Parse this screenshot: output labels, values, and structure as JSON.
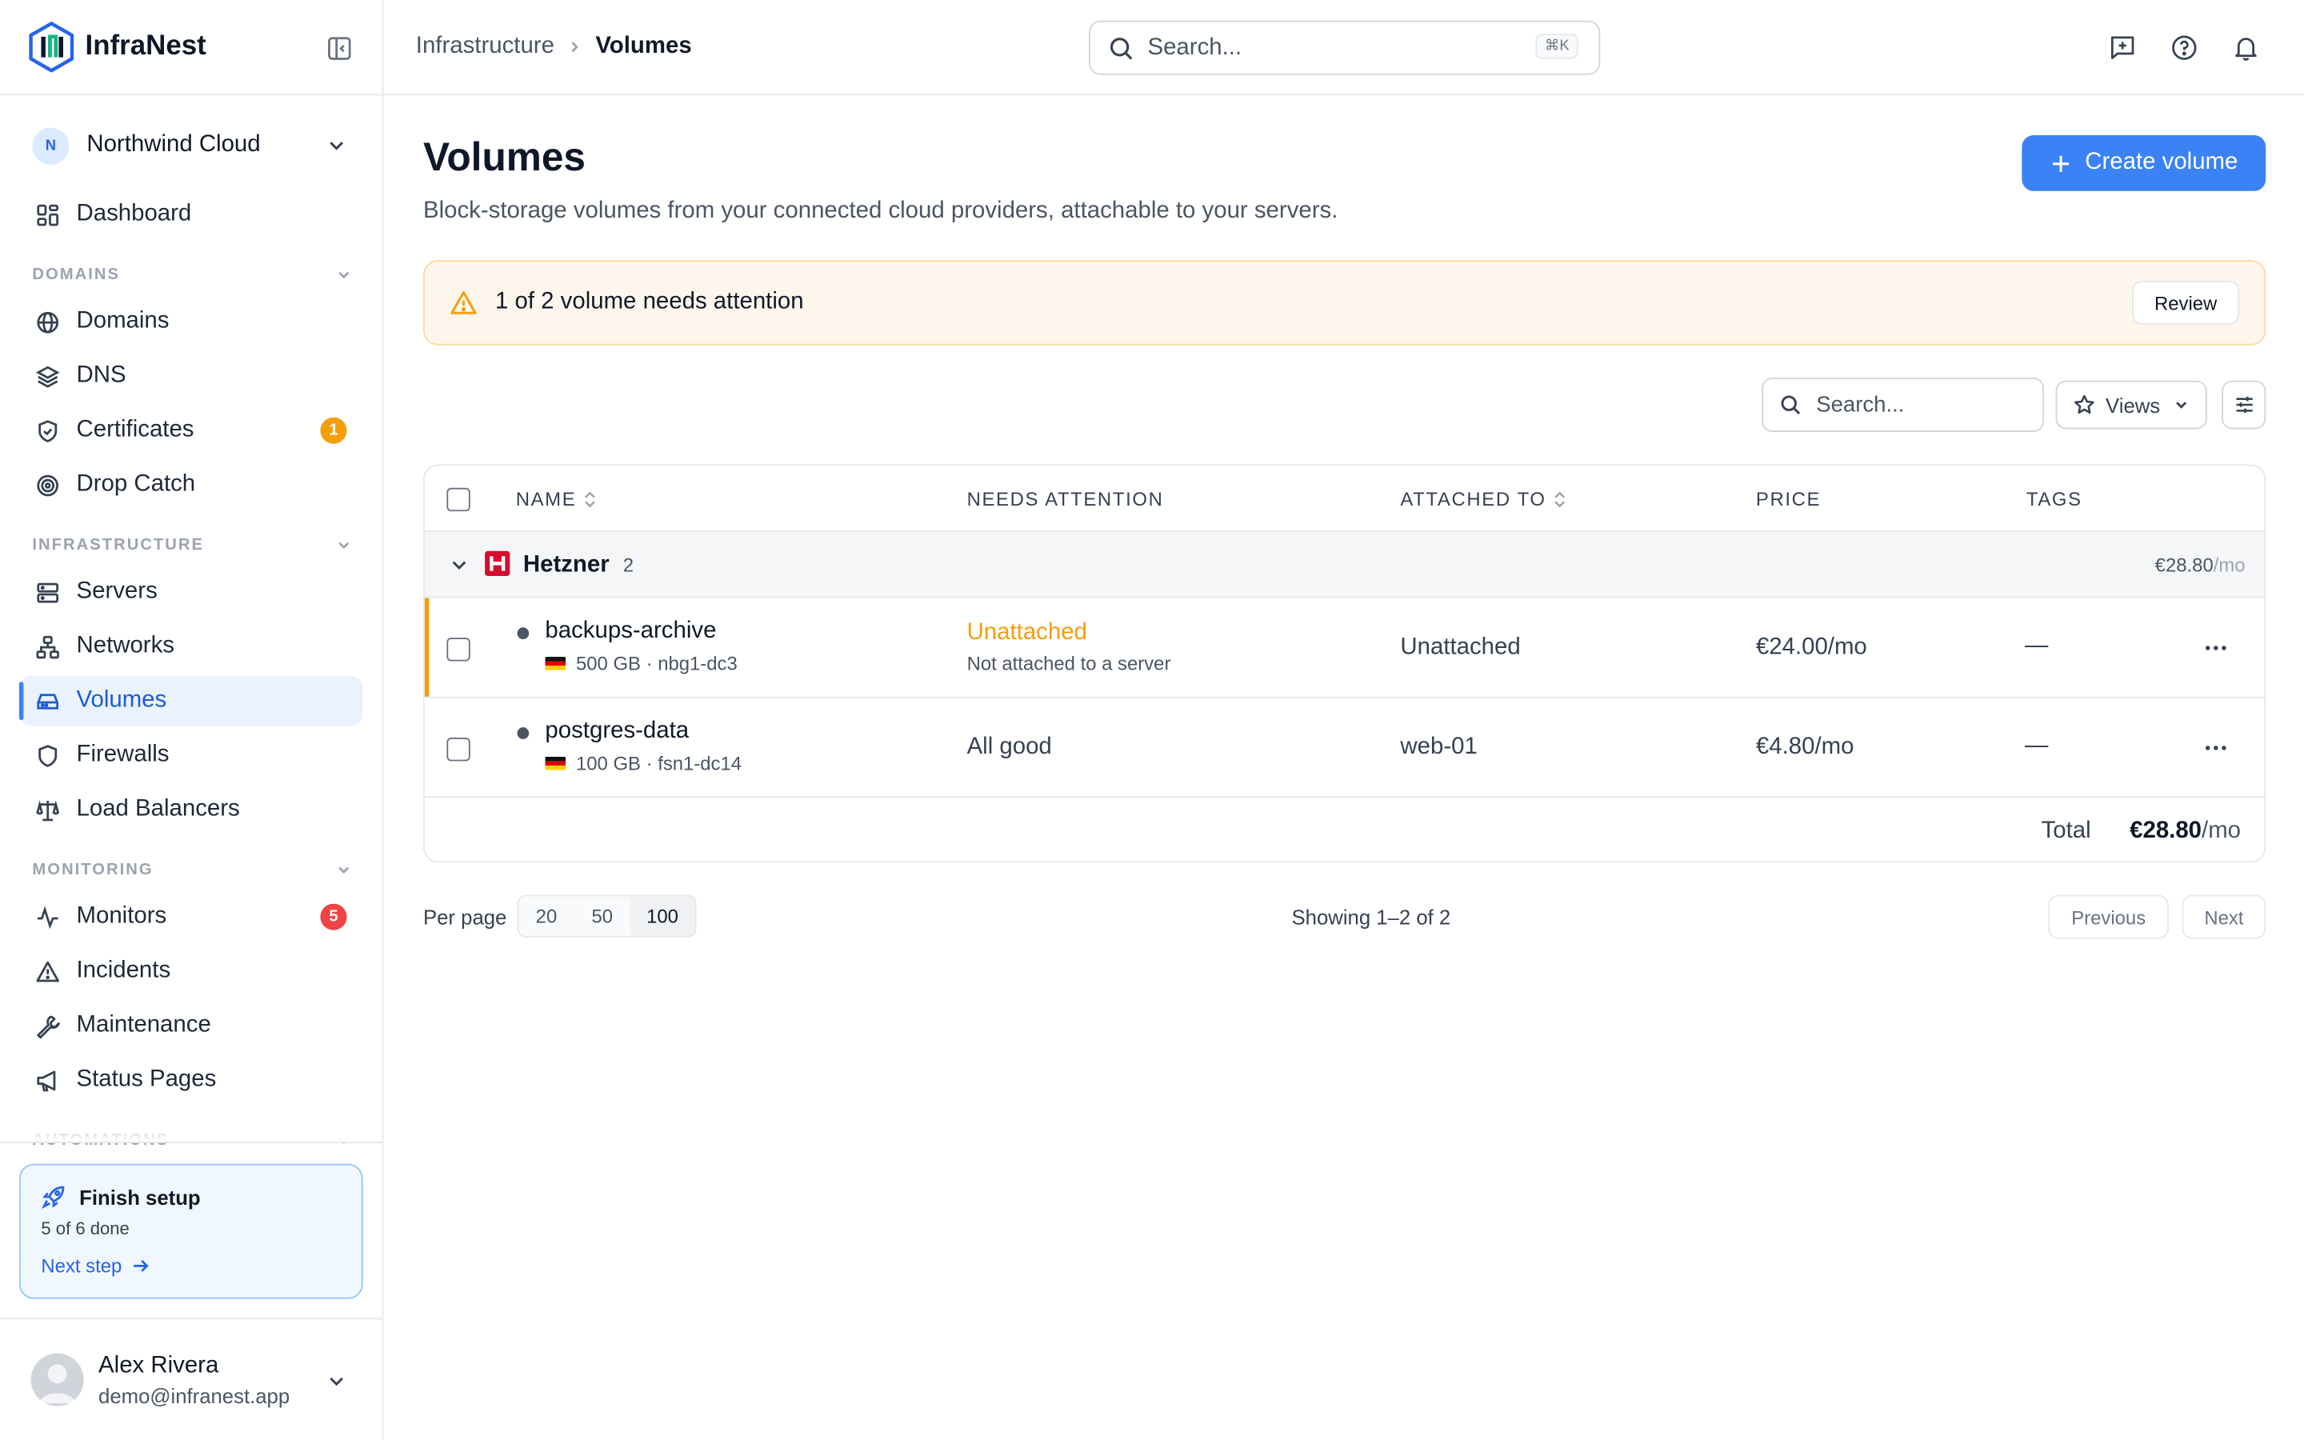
{
  "brand": {
    "name": "InfraNest"
  },
  "org": {
    "initial": "N",
    "name": "Northwind Cloud"
  },
  "nav": {
    "dashboard": "Dashboard",
    "sections": [
      {
        "title": "DOMAINS",
        "items": [
          "Domains",
          "DNS",
          "Certificates",
          "Drop Catch"
        ]
      },
      {
        "title": "INFRASTRUCTURE",
        "items": [
          "Servers",
          "Networks",
          "Volumes",
          "Firewalls",
          "Load Balancers"
        ]
      },
      {
        "title": "MONITORING",
        "items": [
          "Monitors",
          "Incidents",
          "Maintenance",
          "Status Pages"
        ]
      },
      {
        "title": "AUTOMATIONS"
      }
    ],
    "active": "Volumes",
    "badges": {
      "certificates": "1",
      "monitors": "5"
    },
    "badge_colors": {
      "certificates": "#f59e0b",
      "monitors": "#ef4444"
    }
  },
  "setup": {
    "title": "Finish setup",
    "progress": "5 of 6 done",
    "next": "Next step"
  },
  "user": {
    "name": "Alex Rivera",
    "email": "demo@infranest.app"
  },
  "topbar": {
    "breadcrumb": [
      "Infrastructure",
      "Volumes"
    ],
    "search_placeholder": "Search...",
    "shortcut": "⌘K",
    "icons": [
      "feedback-icon",
      "help-icon",
      "bell-icon"
    ]
  },
  "page": {
    "title": "Volumes",
    "description": "Block-storage volumes from your connected cloud providers, attachable to your servers.",
    "create_label": "Create volume"
  },
  "alert": {
    "text": "1 of 2 volume needs attention",
    "action": "Review"
  },
  "toolbar": {
    "search_placeholder": "Search...",
    "views_label": "Views"
  },
  "table": {
    "columns": [
      "NAME",
      "NEEDS ATTENTION",
      "ATTACHED TO",
      "PRICE",
      "TAGS"
    ],
    "group": {
      "name": "Hetzner",
      "count": "2",
      "total": "€28.80",
      "total_unit": "/mo"
    },
    "rows": [
      {
        "name": "backups-archive",
        "meta": "500 GB · nbg1-dc3",
        "attention": "Unattached",
        "attention_detail": "Not attached to a server",
        "attached_to": "Unattached",
        "price": "€24.00/mo",
        "tags": "—"
      },
      {
        "name": "postgres-data",
        "meta": "100 GB · fsn1-dc14",
        "attention": "All good",
        "attached_to": "web-01",
        "price": "€4.80/mo",
        "tags": "—"
      }
    ],
    "footer": {
      "label": "Total",
      "value": "€28.80",
      "unit": "/mo"
    }
  },
  "pagination": {
    "per_page_label": "Per page",
    "options": [
      "20",
      "50",
      "100"
    ],
    "selected": "100",
    "showing": "Showing 1–2 of 2",
    "previous": "Previous",
    "next": "Next"
  },
  "colors": {
    "accent": "#3b82f6",
    "warning": "#f59e0b",
    "danger": "#ef4444",
    "hetzner": "#d50c2d"
  }
}
